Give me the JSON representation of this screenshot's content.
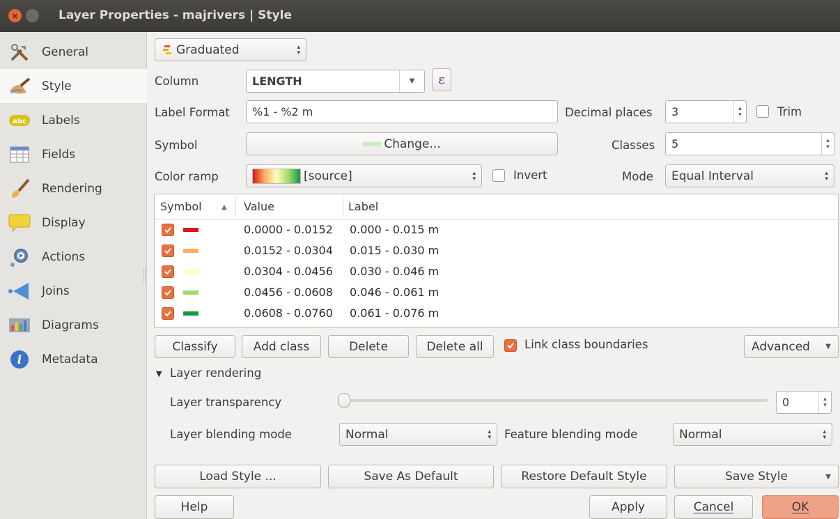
{
  "window": {
    "title": "Layer Properties - majrivers | Style"
  },
  "sidebar": {
    "items": [
      {
        "label": "General",
        "icon": "tools-icon"
      },
      {
        "label": "Style",
        "icon": "paintbrush-icon"
      },
      {
        "label": "Labels",
        "icon": "abc-label-icon"
      },
      {
        "label": "Fields",
        "icon": "table-icon"
      },
      {
        "label": "Rendering",
        "icon": "brush-icon"
      },
      {
        "label": "Display",
        "icon": "speech-bubble-icon"
      },
      {
        "label": "Actions",
        "icon": "gear-actions-icon"
      },
      {
        "label": "Joins",
        "icon": "joins-icon"
      },
      {
        "label": "Diagrams",
        "icon": "diagram-icon"
      },
      {
        "label": "Metadata",
        "icon": "info-icon"
      }
    ],
    "active": "Style"
  },
  "renderer": {
    "type": "Graduated"
  },
  "column": {
    "label": "Column",
    "value": "LENGTH",
    "expr_button": "ε"
  },
  "label_format": {
    "label": "Label Format",
    "value": "%1 - %2 m"
  },
  "decimal_places": {
    "label": "Decimal places",
    "value": "3"
  },
  "trim": {
    "label": "Trim",
    "checked": false
  },
  "symbol": {
    "label": "Symbol",
    "button": "Change..."
  },
  "classes": {
    "label": "Classes",
    "value": "5"
  },
  "color_ramp": {
    "label": "Color ramp",
    "value": "[source]"
  },
  "invert": {
    "label": "Invert",
    "checked": false
  },
  "mode": {
    "label": "Mode",
    "value": "Equal Interval"
  },
  "table": {
    "headers": {
      "symbol": "Symbol",
      "value": "Value",
      "label": "Label",
      "sort": "▲"
    },
    "rows": [
      {
        "value": "0.0000 - 0.0152",
        "label": "0.000 - 0.015 m",
        "color": "#d7191c",
        "checked": true
      },
      {
        "value": "0.0152 - 0.0304",
        "label": "0.015 - 0.030 m",
        "color": "#fdae61",
        "checked": true
      },
      {
        "value": "0.0304 - 0.0456",
        "label": "0.030 - 0.046 m",
        "color": "#ffffbf",
        "checked": true
      },
      {
        "value": "0.0456 - 0.0608",
        "label": "0.046 - 0.061 m",
        "color": "#a6d96a",
        "checked": true
      },
      {
        "value": "0.0608 - 0.0760",
        "label": "0.061 - 0.076 m",
        "color": "#1a9641",
        "checked": true
      }
    ]
  },
  "actions": {
    "classify": "Classify",
    "add_class": "Add class",
    "delete": "Delete",
    "delete_all": "Delete all",
    "link_boundaries": "Link class boundaries",
    "advanced": "Advanced"
  },
  "layer_rendering": {
    "section": "Layer rendering",
    "transparency_label": "Layer transparency",
    "transparency_value": "0",
    "blending_label": "Layer blending mode",
    "blending_value": "Normal",
    "feature_blending_label": "Feature blending mode",
    "feature_blending_value": "Normal"
  },
  "style_buttons": {
    "load": "Load Style ...",
    "save_default": "Save As Default",
    "restore_default": "Restore Default Style",
    "save_style": "Save Style"
  },
  "footer": {
    "help": "Help",
    "apply": "Apply",
    "cancel": "Cancel",
    "ok": "OK"
  },
  "colors": {
    "accent": "#e9703f",
    "ok_button": "#f0a286",
    "titlebar": "#3c3b37"
  }
}
